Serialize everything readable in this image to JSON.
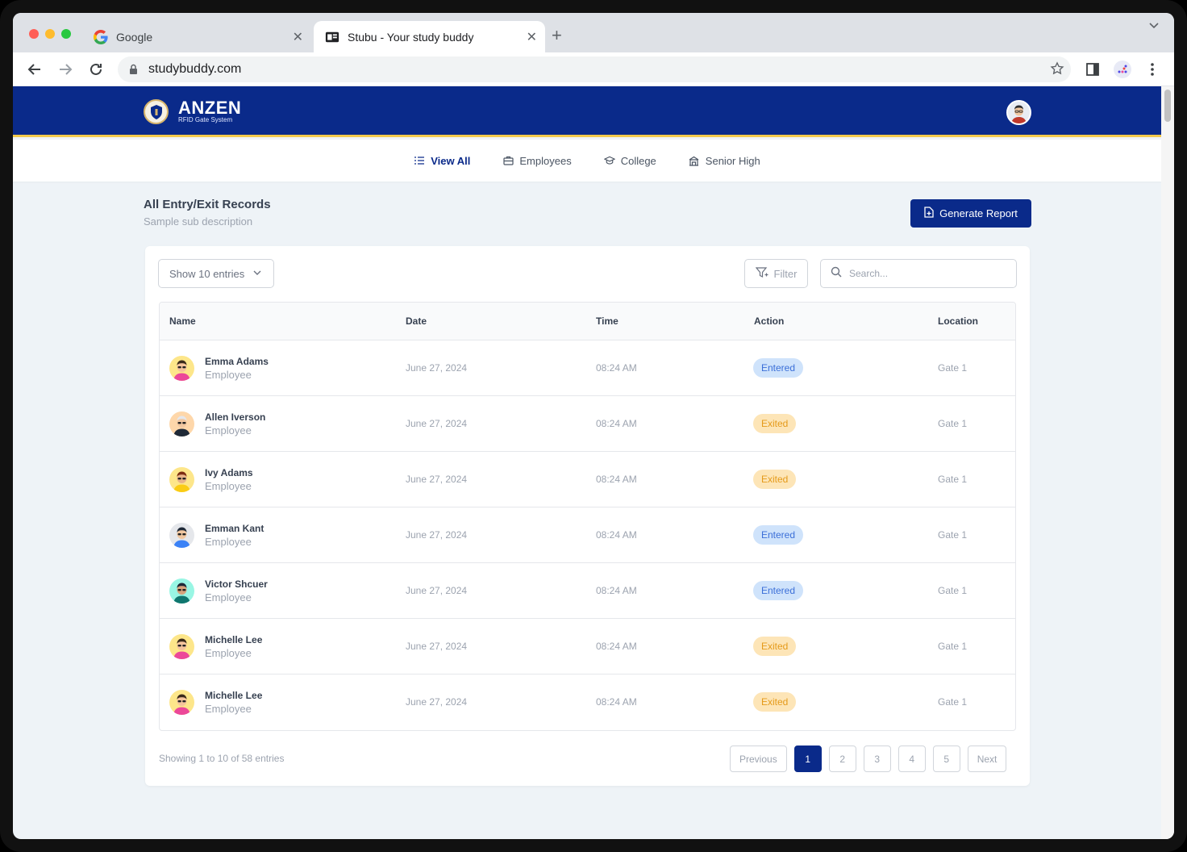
{
  "browser": {
    "tabs": [
      {
        "title": "Google",
        "favicon": "google-g-icon"
      },
      {
        "title": "Stubu - Your study buddy",
        "favicon": "stubu-icon"
      }
    ],
    "url": "studybuddy.com"
  },
  "app": {
    "brand_name": "ANZEN",
    "brand_sub": "RFID Gate System",
    "accent_color": "#0a2a8a",
    "stripe_color": "#f2c94c"
  },
  "subnav": [
    {
      "label": "View All",
      "icon": "list-icon",
      "active": true
    },
    {
      "label": "Employees",
      "icon": "briefcase-icon",
      "active": false
    },
    {
      "label": "College",
      "icon": "graduation-cap-icon",
      "active": false
    },
    {
      "label": "Senior High",
      "icon": "school-building-icon",
      "active": false
    }
  ],
  "page": {
    "title": "All Entry/Exit Records",
    "subtitle": "Sample sub description",
    "generate_label": "Generate Report"
  },
  "controls": {
    "entries_label": "Show 10 entries",
    "filter_label": "Filter",
    "search_placeholder": "Search..."
  },
  "table": {
    "headers": {
      "name": "Name",
      "date": "Date",
      "time": "Time",
      "action": "Action",
      "location": "Location"
    },
    "rows": [
      {
        "name": "Emma Adams",
        "role": "Employee",
        "date": "June 27, 2024",
        "time": "08:24 AM",
        "action": "Entered",
        "location": "Gate 1"
      },
      {
        "name": "Allen Iverson",
        "role": "Employee",
        "date": "June 27, 2024",
        "time": "08:24 AM",
        "action": "Exited",
        "location": "Gate 1"
      },
      {
        "name": "Ivy Adams",
        "role": "Employee",
        "date": "June 27, 2024",
        "time": "08:24 AM",
        "action": "Exited",
        "location": "Gate 1"
      },
      {
        "name": "Emman Kant",
        "role": "Employee",
        "date": "June 27, 2024",
        "time": "08:24 AM",
        "action": "Entered",
        "location": "Gate 1"
      },
      {
        "name": "Victor Shcuer",
        "role": "Employee",
        "date": "June 27, 2024",
        "time": "08:24 AM",
        "action": "Entered",
        "location": "Gate 1"
      },
      {
        "name": "Michelle Lee",
        "role": "Employee",
        "date": "June 27, 2024",
        "time": "08:24 AM",
        "action": "Exited",
        "location": "Gate 1"
      },
      {
        "name": "Michelle Lee",
        "role": "Employee",
        "date": "June 27, 2024",
        "time": "08:24 AM",
        "action": "Exited",
        "location": "Gate 1"
      }
    ]
  },
  "footer": {
    "showing": "Showing 1 to 10 of 58 entries",
    "previous": "Previous",
    "next": "Next",
    "pages": [
      "1",
      "2",
      "3",
      "4",
      "5"
    ],
    "current_page": "1"
  },
  "colors": {
    "entered_bg": "#cfe3fb",
    "entered_text": "#3b6fd8",
    "exited_bg": "#fde5b7",
    "exited_text": "#e59a1a"
  }
}
